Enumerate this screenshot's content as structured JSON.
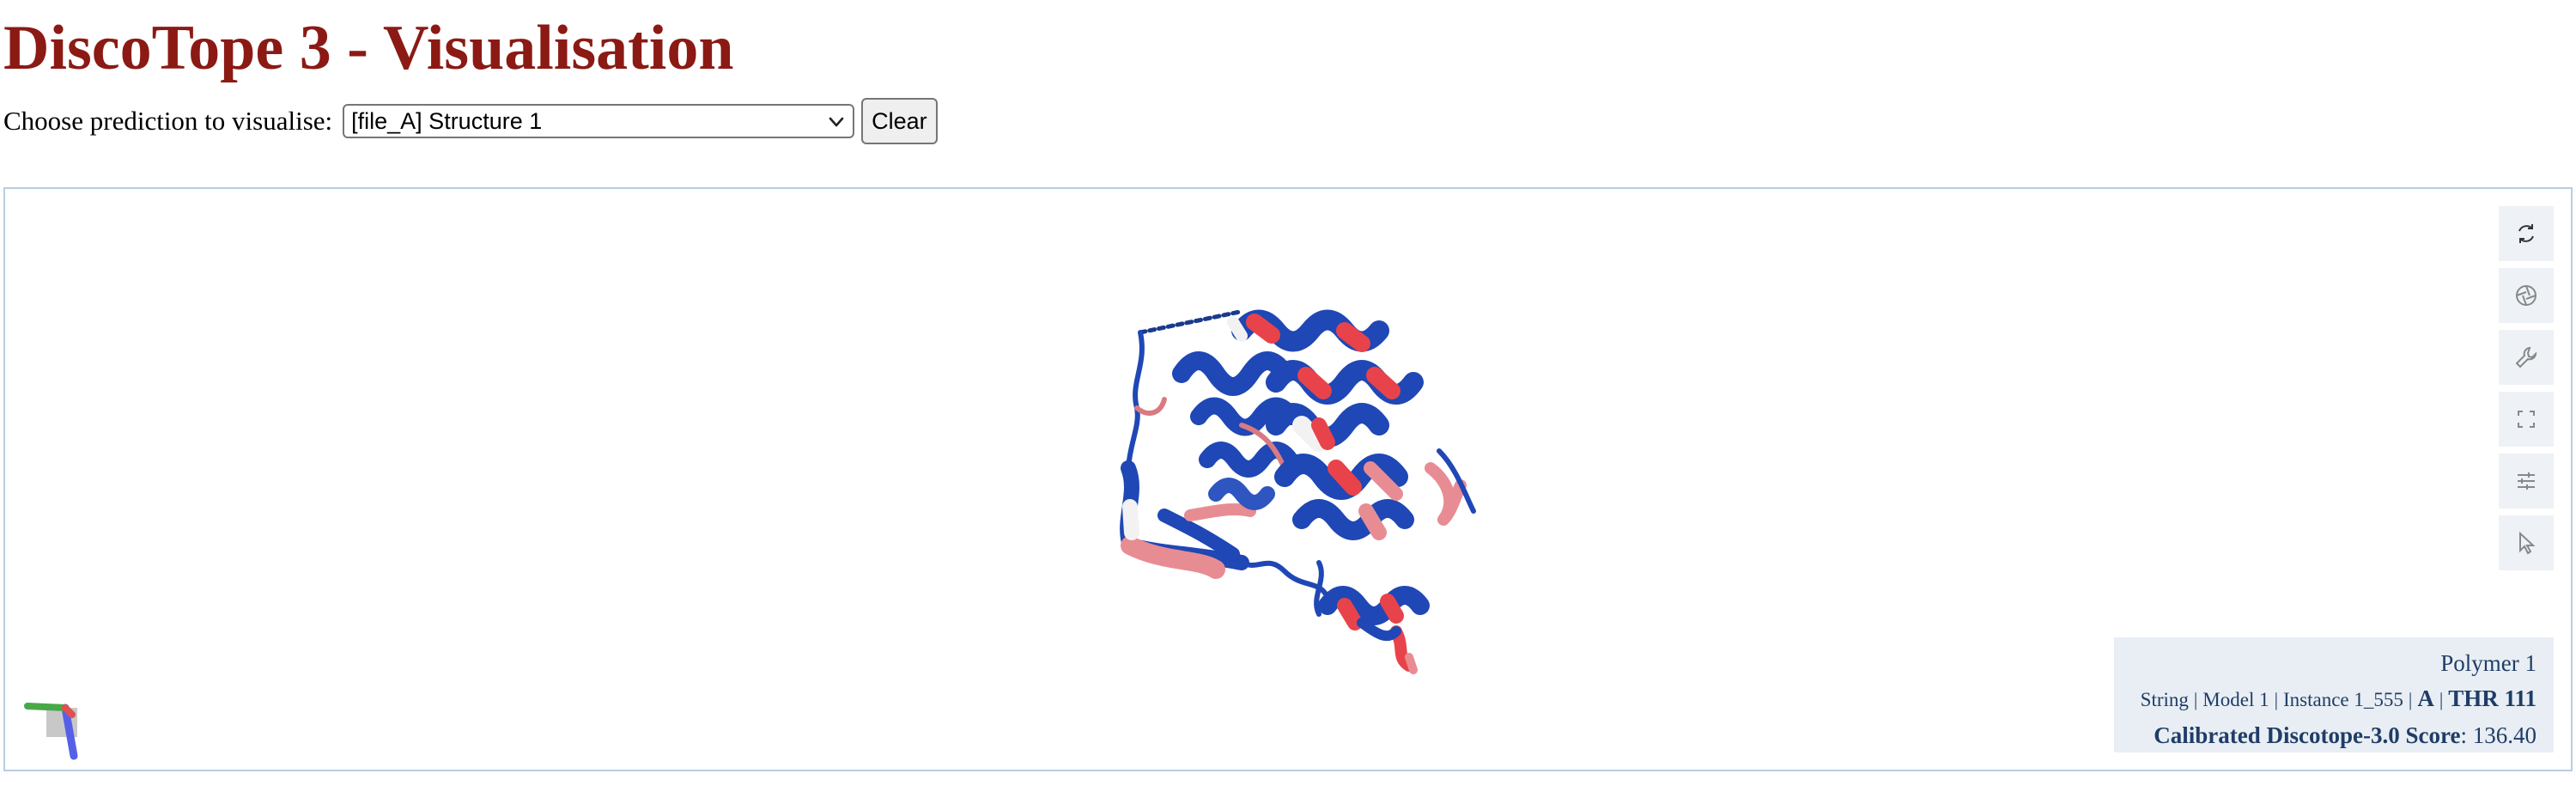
{
  "page": {
    "title": "DiscoTope 3 - Visualisation"
  },
  "controls": {
    "choose_label": "Choose prediction to visualise:",
    "selected_option": "[file_A] Structure 1",
    "clear_label": "Clear"
  },
  "viewer": {
    "toolbar": [
      {
        "name": "reset-camera",
        "icon": "refresh-icon"
      },
      {
        "name": "screenshot",
        "icon": "camera-aperture-icon"
      },
      {
        "name": "settings",
        "icon": "wrench-icon"
      },
      {
        "name": "expand",
        "icon": "fullscreen-icon"
      },
      {
        "name": "controls",
        "icon": "sliders-icon"
      },
      {
        "name": "selection-mode",
        "icon": "cursor-icon"
      }
    ],
    "info": {
      "polymer": "Polymer 1",
      "string": "String",
      "model": "Model 1",
      "instance": "Instance 1_555",
      "chain": "A",
      "residue": "THR 111",
      "score_label": "Calibrated Discotope-3.0 Score",
      "score_value": ": 136.40"
    },
    "colors": {
      "low": "#1f47b5",
      "mid": "#f2f2f2",
      "high": "#e8434a",
      "pink": "#e88c94"
    }
  }
}
